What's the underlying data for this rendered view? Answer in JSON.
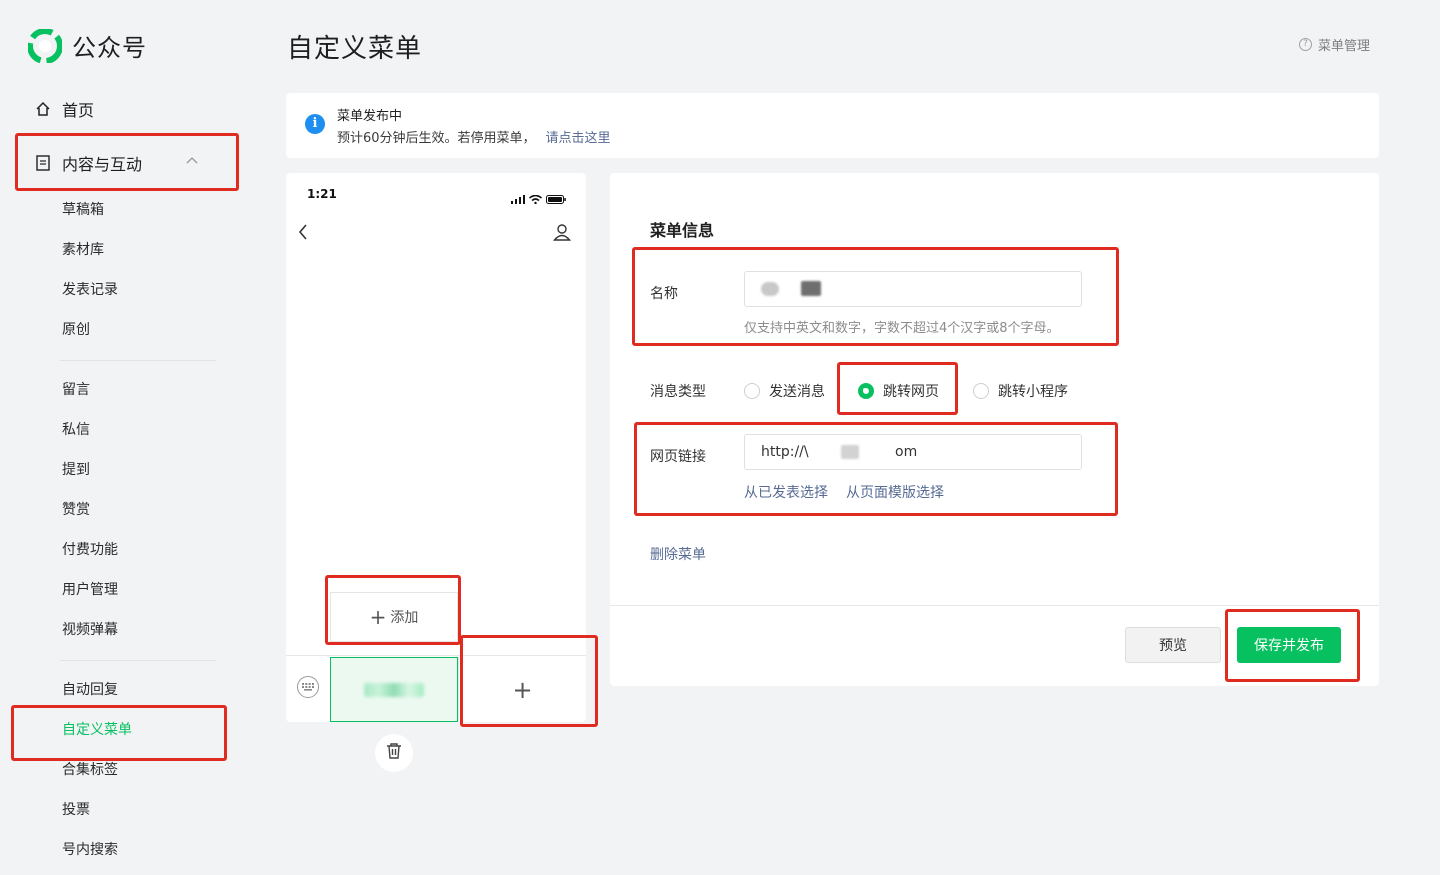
{
  "brand": {
    "name": "公众号",
    "accent": "#07c160"
  },
  "sidebar": {
    "home": "首页",
    "content_group": "内容与互动",
    "items": [
      "草稿箱",
      "素材库",
      "发表记录",
      "原创",
      "留言",
      "私信",
      "提到",
      "赞赏",
      "付费功能",
      "用户管理",
      "视频弹幕",
      "自动回复",
      "自定义菜单",
      "合集标签",
      "投票",
      "号内搜索"
    ],
    "active_item": "自定义菜单"
  },
  "header": {
    "title": "自定义菜单",
    "help": "菜单管理"
  },
  "notice": {
    "title": "菜单发布中",
    "text": "预计60分钟后生效。若停用菜单，",
    "link": "请点击这里"
  },
  "phone": {
    "time": "1:21",
    "submenu_add": "添加",
    "add_icon": "plus-icon"
  },
  "editor": {
    "section_title": "菜单信息",
    "name_label": "名称",
    "name_hint": "仅支持中英文和数字，字数不超过4个汉字或8个字母。",
    "type_label": "消息类型",
    "types": [
      "发送消息",
      "跳转网页",
      "跳转小程序"
    ],
    "selected_type": "跳转网页",
    "url_label": "网页链接",
    "url_prefix": "http://\\",
    "url_suffix": "om",
    "pick_published": "从已发表选择",
    "pick_template": "从页面模版选择",
    "delete": "删除菜单",
    "preview": "预览",
    "save": "保存并发布"
  },
  "colors": {
    "highlight": "#e02b21",
    "link": "#576b95",
    "info": "#1f8ef1"
  }
}
